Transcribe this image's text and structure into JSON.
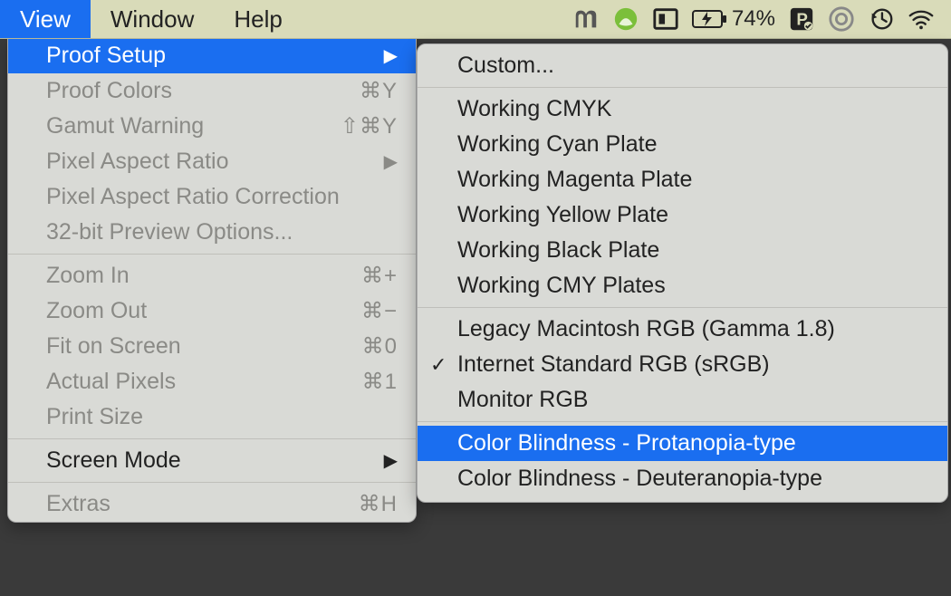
{
  "menubar": {
    "items": [
      "View",
      "Window",
      "Help"
    ],
    "active_index": 0,
    "battery_pct": "74%"
  },
  "view_menu": {
    "rows": [
      {
        "label": "Proof Setup",
        "state": "highlight",
        "right": "arrow"
      },
      {
        "label": "Proof Colors",
        "state": "disabled",
        "shortcut": "⌘Y"
      },
      {
        "label": "Gamut Warning",
        "state": "disabled",
        "shortcut": "⇧⌘Y"
      },
      {
        "label": "Pixel Aspect Ratio",
        "state": "disabled",
        "right": "arrow"
      },
      {
        "label": "Pixel Aspect Ratio Correction",
        "state": "disabled"
      },
      {
        "label": "32-bit Preview Options...",
        "state": "disabled"
      },
      {
        "sep": true
      },
      {
        "label": "Zoom In",
        "state": "disabled",
        "shortcut": "⌘+"
      },
      {
        "label": "Zoom Out",
        "state": "disabled",
        "shortcut": "⌘−"
      },
      {
        "label": "Fit on Screen",
        "state": "disabled",
        "shortcut": "⌘0"
      },
      {
        "label": "Actual Pixels",
        "state": "disabled",
        "shortcut": "⌘1"
      },
      {
        "label": "Print Size",
        "state": "disabled"
      },
      {
        "sep": true
      },
      {
        "label": "Screen Mode",
        "state": "normal",
        "right": "arrow"
      },
      {
        "sep": true
      },
      {
        "label": "Extras",
        "state": "disabled",
        "shortcut": "⌘H"
      }
    ]
  },
  "sub_menu": {
    "rows": [
      {
        "label": "Custom..."
      },
      {
        "sep": true
      },
      {
        "label": "Working CMYK"
      },
      {
        "label": "Working Cyan Plate"
      },
      {
        "label": "Working Magenta Plate"
      },
      {
        "label": "Working Yellow Plate"
      },
      {
        "label": "Working Black Plate"
      },
      {
        "label": "Working CMY Plates"
      },
      {
        "sep": true
      },
      {
        "label": "Legacy Macintosh RGB (Gamma 1.8)"
      },
      {
        "label": "Internet Standard RGB (sRGB)",
        "checked": true
      },
      {
        "label": "Monitor RGB"
      },
      {
        "sep": true
      },
      {
        "label": "Color Blindness - Protanopia-type",
        "state": "highlight"
      },
      {
        "label": "Color Blindness - Deuteranopia-type"
      }
    ]
  }
}
